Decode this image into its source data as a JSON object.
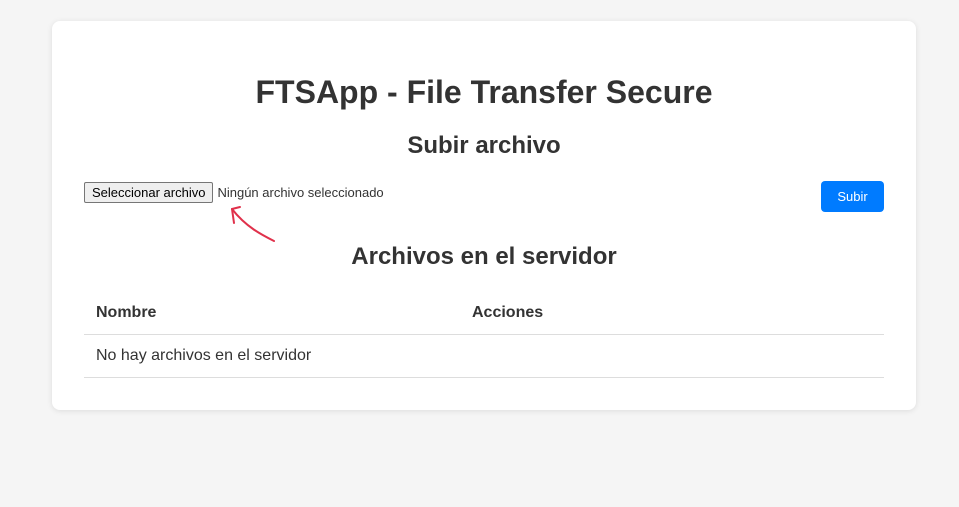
{
  "header": {
    "app_title": "FTSApp - File Transfer Secure"
  },
  "upload": {
    "section_title": "Subir archivo",
    "file_button_label": "Seleccionar archivo",
    "file_status": "Ningún archivo seleccionado",
    "submit_label": "Subir"
  },
  "files": {
    "section_title": "Archivos en el servidor",
    "columns": [
      "Nombre",
      "Acciones"
    ],
    "empty_message": "No hay archivos en el servidor"
  },
  "colors": {
    "page_background": "#f5f5f5",
    "card_background": "#ffffff",
    "primary_button": "#007bff",
    "annotation_arrow": "#e0314b"
  },
  "annotation": {
    "icon": "hand-drawn-arrow-icon"
  }
}
